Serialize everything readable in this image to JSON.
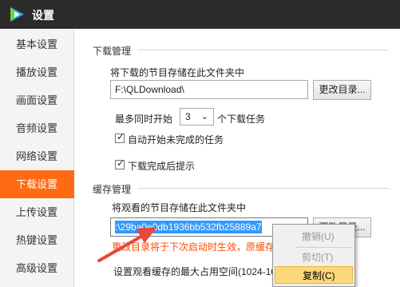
{
  "window": {
    "title": "设置"
  },
  "sidebar": {
    "items": [
      {
        "label": "基本设置",
        "active": false
      },
      {
        "label": "播放设置",
        "active": false
      },
      {
        "label": "画面设置",
        "active": false
      },
      {
        "label": "音频设置",
        "active": false
      },
      {
        "label": "网络设置",
        "active": false
      },
      {
        "label": "下载设置",
        "active": true
      },
      {
        "label": "上传设置",
        "active": false
      },
      {
        "label": "热键设置",
        "active": false
      },
      {
        "label": "高级设置",
        "active": false
      }
    ]
  },
  "download": {
    "section_title": "下载管理",
    "folder_label": "将下载的节目存储在此文件夹中",
    "folder_path": "F:\\QLDownload\\",
    "change_dir_button": "更改目录...",
    "max_prefix": "最多同时开始",
    "max_value": "3",
    "max_suffix": "个下载任务",
    "auto_start_label": "自动开始未完成的任务",
    "auto_start_checked": true,
    "notify_label": "下载完成后提示",
    "notify_checked": true
  },
  "cache": {
    "section_title": "缓存管理",
    "folder_label": "将观看的节目存储在此文件夹中",
    "folder_path": ":\\29ba0e0db1936bb532fb25889a7",
    "change_dir_button": "更改目录...",
    "warning": "更改目录将于下次启动时生效，原缓存",
    "max_space_label": "设置观看缓存的最大占用空间(1024-10"
  },
  "context_menu": {
    "items": [
      {
        "label": "撤销(U)",
        "enabled": false
      },
      {
        "label": "剪切(T)",
        "enabled": false
      },
      {
        "label": "复制(C)",
        "enabled": true,
        "highlighted": true
      }
    ]
  },
  "colors": {
    "accent": "#ff6a13",
    "titlebar": "#2b2b2b",
    "selection": "#3399ff",
    "warning": "#ff4a00",
    "menu_highlight": "#fbd97a",
    "arrow": "#e8473d"
  }
}
